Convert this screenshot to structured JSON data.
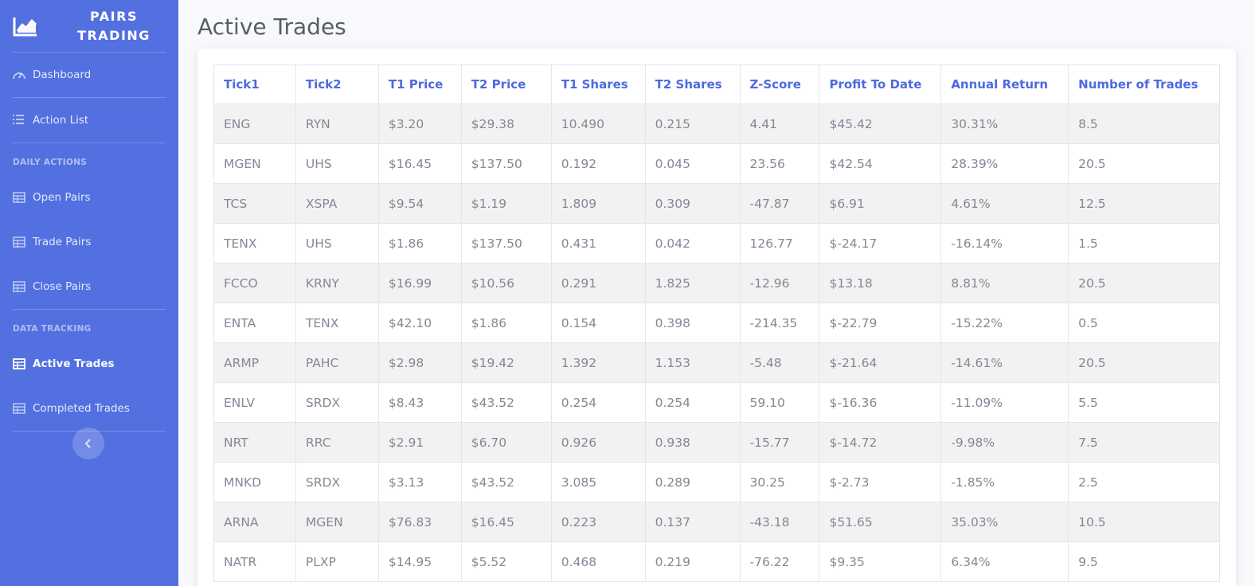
{
  "brand": {
    "line1": "PAIRS",
    "line2": "TRADING",
    "icon": "chart-area-icon"
  },
  "sidebar": {
    "items_top": [
      {
        "label": "Dashboard",
        "icon": "tachometer-icon"
      },
      {
        "label": "Action List",
        "icon": "list-icon"
      }
    ],
    "section_daily": "DAILY ACTIONS",
    "items_daily": [
      {
        "label": "Open Pairs",
        "icon": "table-icon"
      },
      {
        "label": "Trade Pairs",
        "icon": "table-icon"
      },
      {
        "label": "Close Pairs",
        "icon": "table-icon"
      }
    ],
    "section_tracking": "DATA TRACKING",
    "items_tracking": [
      {
        "label": "Active Trades",
        "icon": "table-icon",
        "active": true
      },
      {
        "label": "Completed Trades",
        "icon": "table-icon"
      }
    ],
    "toggle_icon": "chevron-left-icon"
  },
  "page": {
    "title": "Active Trades"
  },
  "table": {
    "columns": [
      "Tick1",
      "Tick2",
      "T1 Price",
      "T2 Price",
      "T1 Shares",
      "T2 Shares",
      "Z-Score",
      "Profit To Date",
      "Annual Return",
      "Number of Trades"
    ],
    "rows": [
      [
        "ENG",
        "RYN",
        "$3.20",
        "$29.38",
        "10.490",
        "0.215",
        "4.41",
        "$45.42",
        "30.31%",
        "8.5"
      ],
      [
        "MGEN",
        "UHS",
        "$16.45",
        "$137.50",
        "0.192",
        "0.045",
        "23.56",
        "$42.54",
        "28.39%",
        "20.5"
      ],
      [
        "TCS",
        "XSPA",
        "$9.54",
        "$1.19",
        "1.809",
        "0.309",
        "-47.87",
        "$6.91",
        "4.61%",
        "12.5"
      ],
      [
        "TENX",
        "UHS",
        "$1.86",
        "$137.50",
        "0.431",
        "0.042",
        "126.77",
        "$-24.17",
        "-16.14%",
        "1.5"
      ],
      [
        "FCCO",
        "KRNY",
        "$16.99",
        "$10.56",
        "0.291",
        "1.825",
        "-12.96",
        "$13.18",
        "8.81%",
        "20.5"
      ],
      [
        "ENTA",
        "TENX",
        "$42.10",
        "$1.86",
        "0.154",
        "0.398",
        "-214.35",
        "$-22.79",
        "-15.22%",
        "0.5"
      ],
      [
        "ARMP",
        "PAHC",
        "$2.98",
        "$19.42",
        "1.392",
        "1.153",
        "-5.48",
        "$-21.64",
        "-14.61%",
        "20.5"
      ],
      [
        "ENLV",
        "SRDX",
        "$8.43",
        "$43.52",
        "0.254",
        "0.254",
        "59.10",
        "$-16.36",
        "-11.09%",
        "5.5"
      ],
      [
        "NRT",
        "RRC",
        "$2.91",
        "$6.70",
        "0.926",
        "0.938",
        "-15.77",
        "$-14.72",
        "-9.98%",
        "7.5"
      ],
      [
        "MNKD",
        "SRDX",
        "$3.13",
        "$43.52",
        "3.085",
        "0.289",
        "30.25",
        "$-2.73",
        "-1.85%",
        "2.5"
      ],
      [
        "ARNA",
        "MGEN",
        "$76.83",
        "$16.45",
        "0.223",
        "0.137",
        "-43.18",
        "$51.65",
        "35.03%",
        "10.5"
      ],
      [
        "NATR",
        "PLXP",
        "$14.95",
        "$5.52",
        "0.468",
        "0.219",
        "-76.22",
        "$9.35",
        "6.34%",
        "9.5"
      ]
    ]
  },
  "colors": {
    "sidebar": "#5270e0",
    "accent": "#4e6ae0",
    "text_muted": "#858796"
  }
}
